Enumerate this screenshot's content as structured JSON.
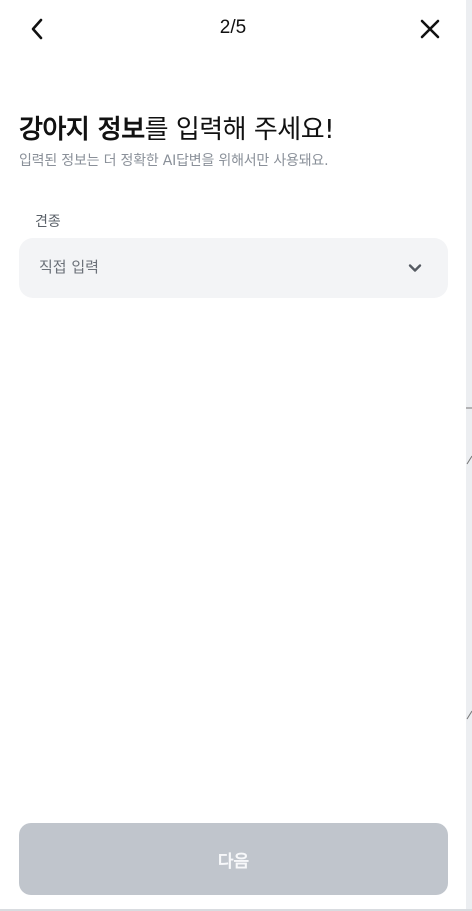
{
  "header": {
    "step": "2/5",
    "back_icon": "chevron-left-icon",
    "close_icon": "close-icon"
  },
  "title": {
    "bold_part": "강아지 정보",
    "rest_part": "를 입력해 주세요!"
  },
  "subtitle": "입력된 정보는 더 정확한 AI답변을 위해서만 사용돼요.",
  "breed_field": {
    "label": "견종",
    "value": "직접 입력",
    "chevron_icon": "chevron-down-icon"
  },
  "footer": {
    "next_label": "다음",
    "next_enabled": false
  },
  "colors": {
    "background": "#ffffff",
    "field_background": "#f3f4f6",
    "button_disabled": "#c0c5cc",
    "subtitle_text": "#8a9099"
  }
}
